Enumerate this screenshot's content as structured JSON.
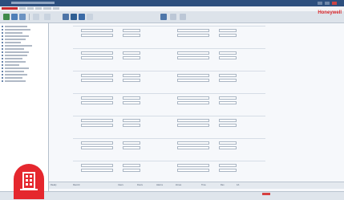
{
  "brand": {
    "name": "Honeywell"
  },
  "toolbar": {
    "buttons": [
      "open-icon",
      "save-icon",
      "print-icon",
      "back-icon",
      "forward-icon",
      "refresh-icon",
      "gear-icon",
      "help-icon",
      "filter-icon",
      "zoom-icon"
    ]
  },
  "statusbar": {
    "items": [
      "Ready",
      "Record",
      "Users",
      "Doors",
      "Alarms",
      "Zones",
      "Time",
      "Rev",
      "1/1"
    ]
  },
  "overlay": {
    "icon": "building-icon",
    "color": "#e5272e"
  }
}
